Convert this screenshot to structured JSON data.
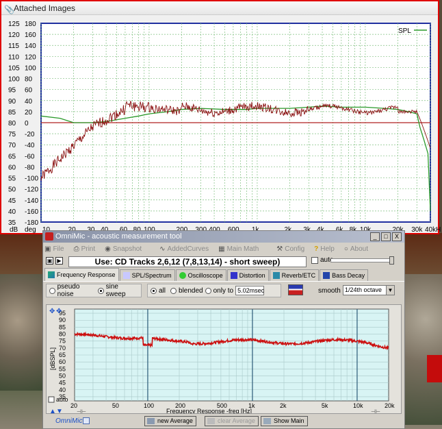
{
  "attached": {
    "header": "Attached Images",
    "graph": {
      "legend": "SPL",
      "left_axis_db": [
        "125",
        "120",
        "115",
        "110",
        "105",
        "100",
        "95",
        "90",
        "85",
        "80",
        "75",
        "70",
        "65",
        "60",
        "55",
        "50",
        "45",
        "40",
        "35"
      ],
      "left_axis_deg": [
        "180",
        "160",
        "140",
        "120",
        "100",
        "80",
        "60",
        "40",
        "20",
        "0",
        "-20",
        "-40",
        "-60",
        "-80",
        "-100",
        "-120",
        "-140",
        "-160",
        "-180"
      ],
      "unit_db": "dB",
      "unit_deg": "deg",
      "x_ticks": [
        "10",
        "20",
        "30",
        "40",
        "60",
        "80",
        "100",
        "200",
        "300",
        "400",
        "600",
        "1k",
        "2k",
        "3k",
        "4k",
        "6k",
        "8k",
        "10k",
        "20k",
        "30k",
        "40kHz"
      ]
    }
  },
  "omni": {
    "title": "OmniMic - acoustic measurement tool",
    "menu": [
      {
        "icon": "disk-icon",
        "label": "File"
      },
      {
        "icon": "printer-icon",
        "label": "Print"
      },
      {
        "icon": "camera-icon",
        "label": "Snapshot"
      },
      {
        "icon": "curves-icon",
        "label": "AddedCurves"
      },
      {
        "icon": "calculator-icon",
        "label": "Main Math"
      },
      {
        "icon": "wrench-icon",
        "label": "Config"
      },
      {
        "icon": "question-icon",
        "label": "Help"
      },
      {
        "icon": "speech-icon",
        "label": "About"
      }
    ],
    "use_text": "Use: CD Tracks 2,6,12 (7,8,13,14) - short sweep)",
    "auto_label": "auto",
    "tabs": [
      "Frequency Response",
      "SPL/Spectrum",
      "Oscilloscope",
      "Distortion",
      "Reverb/ETC",
      "Bass Decay"
    ],
    "signal": {
      "pseudo_noise": "pseudo noise",
      "sine_sweep": "sine sweep"
    },
    "gating": {
      "all": "all",
      "blended": "blended",
      "only_to": "only to",
      "msec": "5.02msec"
    },
    "smooth": {
      "label": "smooth",
      "value": "1/24th octave"
    },
    "graph": {
      "ylabel": "[dBSPL]",
      "y_ticks": [
        "95",
        "90",
        "85",
        "80",
        "75",
        "70",
        "65",
        "60",
        "55",
        "50",
        "45",
        "40",
        "35"
      ],
      "x_ticks": [
        "20",
        "50",
        "100",
        "200",
        "500",
        "1k",
        "2k",
        "5k",
        "10k",
        "20k"
      ],
      "xlabel": "Frequency Response -freq [Hz]",
      "auto": "auto"
    },
    "buttons": {
      "new_average": "new Average",
      "clear_average": "clear Average",
      "show_main": "Show Main"
    },
    "logo": "OmniMic"
  },
  "colors": {
    "accent_red": "#e00000",
    "curve_red": "#cc1010",
    "curve_green": "#2a9a2a",
    "plot_blue": "#2030a0",
    "plot_cyan": "#d8f4f4"
  }
}
